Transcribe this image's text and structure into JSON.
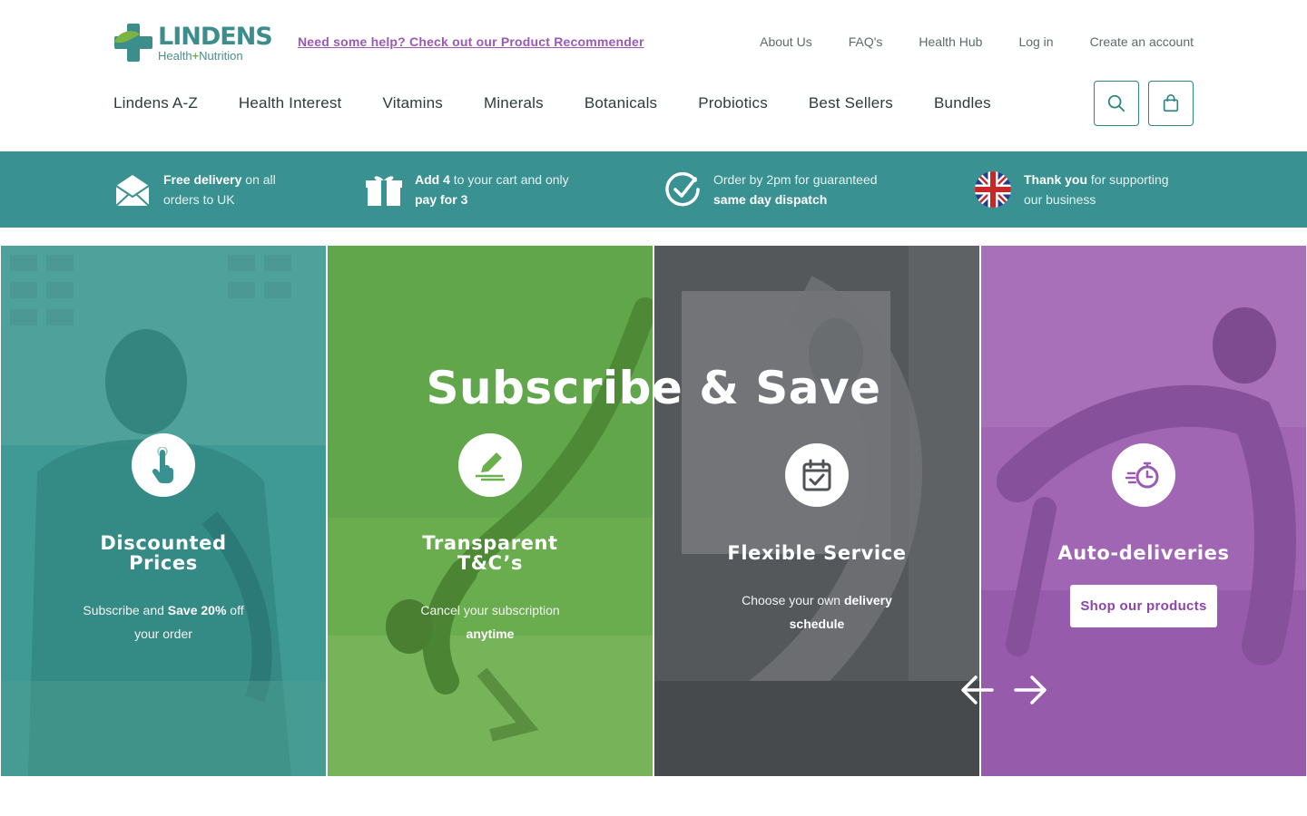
{
  "header": {
    "logo_name": "LINDENS",
    "logo_sub_left": "Health",
    "logo_sub_plus": "+",
    "logo_sub_right": "Nutrition",
    "help_link": "Need some help? Check out our Product Recommender",
    "top_links": [
      "About Us",
      "FAQ's",
      "Health Hub",
      "Log in",
      "Create an account"
    ],
    "nav": [
      "Lindens A-Z",
      "Health Interest",
      "Vitamins",
      "Minerals",
      "Botanicals",
      "Probiotics",
      "Best Sellers",
      "Bundles"
    ],
    "icons": [
      "search-icon",
      "shopping-bag-icon"
    ]
  },
  "usp": [
    {
      "bold": "Free delivery",
      "text1": " on all",
      "line2": "orders to UK",
      "icon": "envelope-icon"
    },
    {
      "bold": "Add 4",
      "text1": " to your cart and only",
      "line2": "pay for 3",
      "icon": "gift-icon"
    },
    {
      "pre": "Order by 2pm for guaranteed",
      "line2": "same day dispatch",
      "icon": "check-clock-icon"
    },
    {
      "bold": "Thank you",
      "text1": " for supporting",
      "line2": "our business",
      "icon": "uk-flag-icon"
    }
  ],
  "hero": {
    "title": "Subscribe & Save",
    "panels": [
      {
        "title_l1": "Discounted",
        "title_l2": "Prices",
        "text_a": "Subscribe and ",
        "text_b": "Save 20%",
        "text_c": " off",
        "text_d": "your order",
        "icon": "tap-hand-icon",
        "color": "#3a9191"
      },
      {
        "title_l1": "Transparent",
        "title_l2": "T&C’s",
        "text_a": "Cancel your subscription",
        "text_b": "anytime",
        "icon": "pen-sign-icon",
        "color": "#6ab04c"
      },
      {
        "title_l1": "Flexible Service",
        "text_a": "Choose your own ",
        "text_b": "delivery",
        "text_c": "schedule",
        "icon": "calendar-check-icon",
        "color": "#4f5255"
      },
      {
        "title_l1": "Auto-deliveries",
        "button": "Shop our products",
        "icon": "fast-timer-icon",
        "color": "#9b59b6"
      }
    ]
  },
  "colors": {
    "teal": "#3a9191",
    "purple": "#9b59b6",
    "green": "#6ab04c",
    "grey": "#4f5255"
  }
}
